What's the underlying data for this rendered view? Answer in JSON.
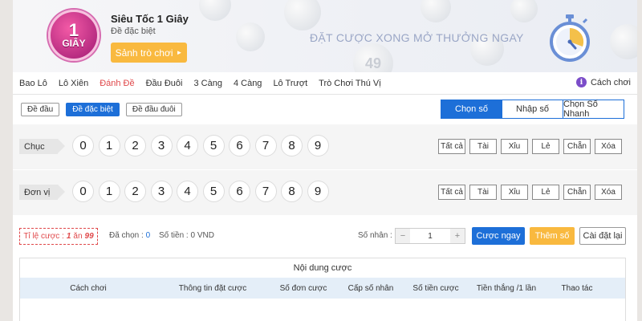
{
  "header": {
    "logo_line1": "1",
    "logo_line2": "GIÂY",
    "game_title": "Siêu Tốc 1 Giây",
    "game_subtitle": "Đề đặc biệt",
    "hall_button": "Sảnh trò chơi",
    "slogan": "ĐẶT CƯỢC XONG MỞ THƯỞNG NGAY",
    "bg_ball_numbers": [
      "49"
    ]
  },
  "nav": {
    "items": [
      "Bao Lô",
      "Lô Xiên",
      "Đánh Đề",
      "Đầu Đuôi",
      "3 Càng",
      "4 Càng",
      "Lô Trượt",
      "Trò Chơi Thú Vị"
    ],
    "active_index": 2,
    "howto_label": "Cách chơi",
    "howto_icon": "info-icon"
  },
  "subtabs": [
    "Đề đầu",
    "Đề đặc biệt",
    "Đề đầu đuôi"
  ],
  "subtab_active": 1,
  "modes": [
    "Chọn số",
    "Nhập số",
    "Chọn Số Nhanh"
  ],
  "mode_active": 0,
  "rows": [
    {
      "label": "Chục",
      "numbers": [
        "0",
        "1",
        "2",
        "3",
        "4",
        "5",
        "6",
        "7",
        "8",
        "9"
      ]
    },
    {
      "label": "Đơn vị",
      "numbers": [
        "0",
        "1",
        "2",
        "3",
        "4",
        "5",
        "6",
        "7",
        "8",
        "9"
      ]
    }
  ],
  "quick_buttons": [
    "Tất cả",
    "Tài",
    "Xỉu",
    "Lẻ",
    "Chẵn",
    "Xóa"
  ],
  "summary": {
    "odds_label": "Tỉ lệ cược :",
    "odds_base": "1",
    "odds_mid": "ăn",
    "odds_value": "99",
    "selected_label": "Đã chọn :",
    "selected_value": "0",
    "amount_label": "Số tiền :",
    "amount_value": "0 VND",
    "multiplier_label": "Số nhân :",
    "multiplier_value": "1",
    "bet_now": "Cược ngay",
    "add_number": "Thêm số",
    "reset": "Cài đặt lại"
  },
  "bet_table": {
    "title": "Nội dung cược",
    "columns": [
      "Cách chơi",
      "Thông tin đặt cược",
      "Số đơn cược",
      "Cấp số nhân",
      "Số tiền cược",
      "Tiền thắng /1 lần",
      "Thao tác"
    ]
  },
  "colors": {
    "primary": "#1d6fd8",
    "accent_orange": "#f9b93f",
    "active_red": "#e0484a",
    "slogan": "#9aa6c6"
  }
}
